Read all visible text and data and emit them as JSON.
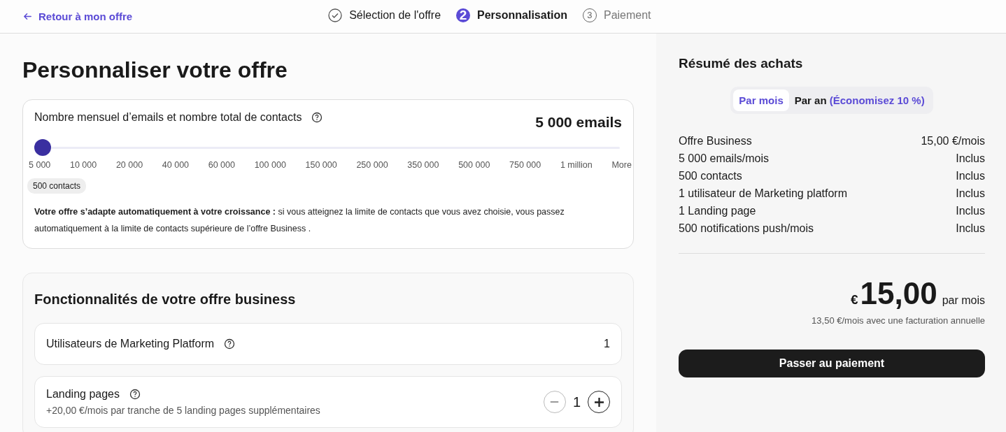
{
  "header": {
    "back_link": "Retour à mon offre",
    "steps": [
      {
        "label": "Sélection de l'offre",
        "completed": true,
        "selected": false
      },
      {
        "label": "Personnalisation",
        "number": "2",
        "completed": false,
        "selected": true
      },
      {
        "label": "Paiement",
        "number": "3",
        "completed": false,
        "selected": false
      }
    ]
  },
  "title": "Personnaliser votre offre",
  "volume": {
    "label": "Nombre mensuel d’emails et nombre total de contacts",
    "value": "5 000 emails",
    "level": 0,
    "ticks": [
      "5 000",
      "10 000",
      "20 000",
      "40 000",
      "60 000",
      "100 000",
      "150 000",
      "250 000",
      "350 000",
      "500 000",
      "750 000",
      "1 million",
      "More"
    ],
    "contacts_badge": "500 contacts",
    "note": "**Votre offre s’adapte automatiquement à votre croissance :** si vous atteignez la limite de contacts que vous avez choisie, vous passez automatiquement à la limite de contacts supérieure de l’offre Business ."
  },
  "features": {
    "title": "Fonctionnalités de votre offre business",
    "items": [
      {
        "kind": "static",
        "label": "Utilisateurs de Marketing Platform",
        "value": "1"
      },
      {
        "kind": "stepper",
        "label": "Landing pages",
        "description": "+20,00 €/mois par tranche de 5 landing pages supplémentaires",
        "value": "1",
        "decrement_disabled": true
      }
    ]
  },
  "summary": {
    "title": "Résumé des achats",
    "billing": [
      {
        "label": "Par mois",
        "selected": true
      },
      {
        "label": "Par an",
        "extra": "(Économisez 10 %)",
        "selected": false
      }
    ],
    "lines": [
      {
        "label": "Offre Business",
        "value": "15,00 €/mois"
      },
      {
        "label": "5 000 emails/mois",
        "value": "Inclus"
      },
      {
        "label": "500 contacts",
        "value": "Inclus"
      },
      {
        "label": "1 utilisateur de Marketing platform",
        "value": "Inclus"
      },
      {
        "label": "1 Landing page",
        "value": "Inclus"
      },
      {
        "label": "500 notifications push/mois",
        "value": "Inclus"
      }
    ],
    "currency": "€",
    "amount": "15,00",
    "period": "par mois",
    "annual_note": "13,50 €/mois avec une facturation annuelle",
    "pay_button": "Passer au paiement"
  }
}
